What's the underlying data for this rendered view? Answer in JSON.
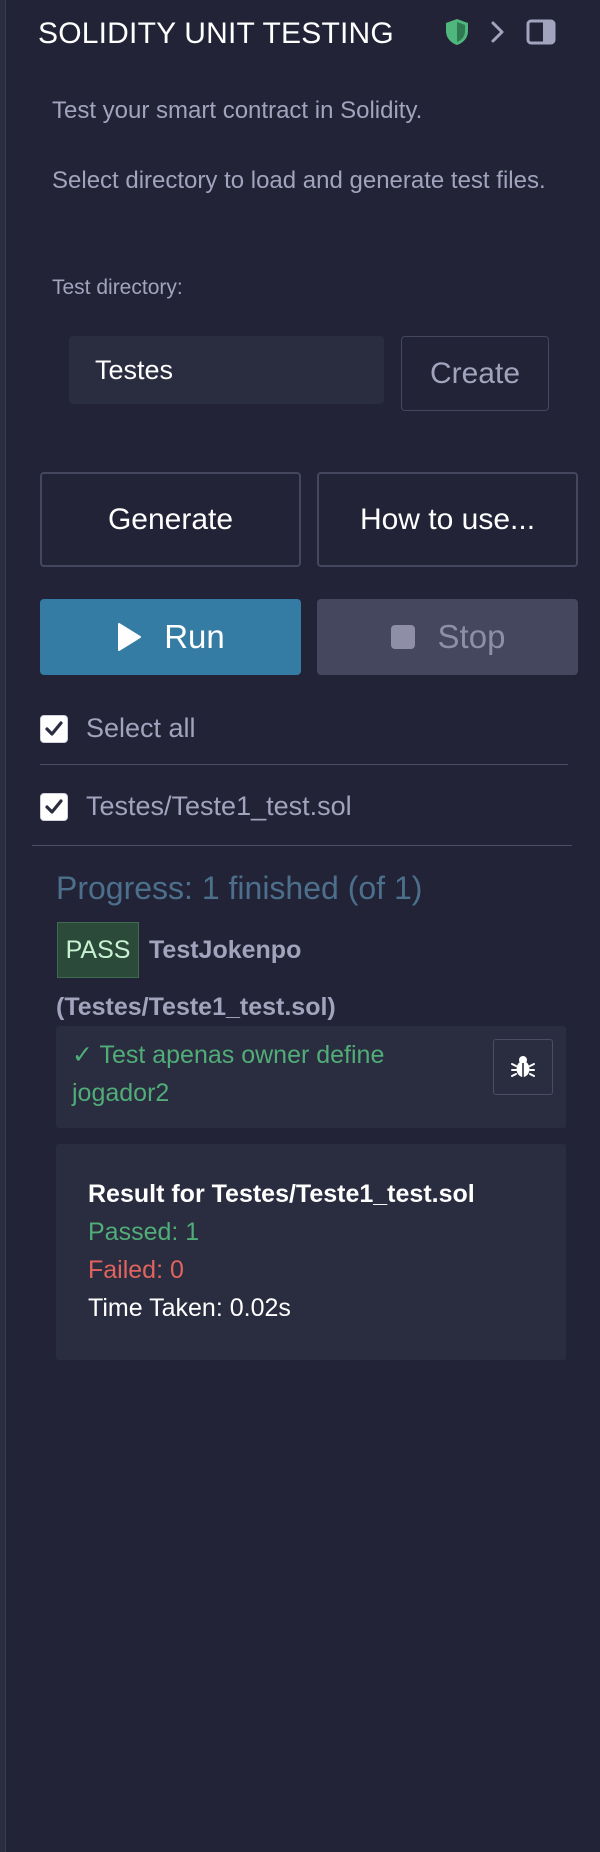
{
  "header": {
    "title": "SOLIDITY UNIT TESTING",
    "icons": [
      "shield-icon",
      "chevron-right-icon",
      "panel-toggle-icon"
    ]
  },
  "intro": {
    "line1": "Test your smart contract in Solidity.",
    "line2": "Select directory to load and generate test files."
  },
  "directory": {
    "label": "Test directory:",
    "value": "Testes",
    "create_label": "Create"
  },
  "actions": {
    "generate_label": "Generate",
    "howto_label": "How to use...",
    "run_label": "Run",
    "stop_label": "Stop"
  },
  "files": {
    "select_all_label": "Select all",
    "items": [
      {
        "label": "Testes/Teste1_test.sol",
        "checked": true
      }
    ]
  },
  "progress": {
    "text": "Progress: 1 finished (of 1)"
  },
  "suite": {
    "status": "PASS",
    "name": "TestJokenpo",
    "file": "(Testes/Teste1_test.sol)",
    "test_case": "✓ Test apenas owner define jogador2"
  },
  "result": {
    "title": "Result for Testes/Teste1_test.sol",
    "passed": "Passed: 1",
    "failed": "Failed: 0",
    "time": "Time Taken: 0.02s"
  },
  "colors": {
    "background": "#222336",
    "run_button": "#357ca5",
    "stop_button": "#45475e",
    "passed": "#51ad78",
    "failed": "#e0645d",
    "progress": "#4c6f8c",
    "shield": "#4fb67e"
  }
}
